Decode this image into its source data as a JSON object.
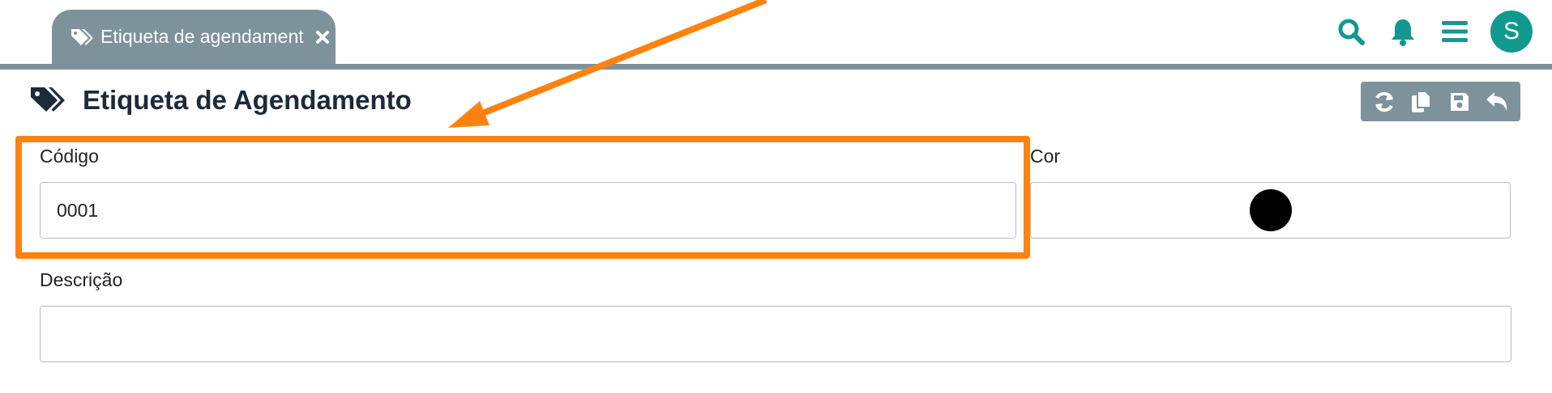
{
  "tab": {
    "label": "Etiqueta de agendament",
    "icon": "tags-icon",
    "close_icon": "close-icon"
  },
  "topbar": {
    "icons": [
      "search-icon",
      "bell-icon",
      "menu-icon"
    ],
    "avatar_initial": "S",
    "accent": "#12998e"
  },
  "header": {
    "title": "Etiqueta de Agendamento",
    "icon": "tags-icon"
  },
  "actions": {
    "icons": [
      "refresh-icon",
      "copy-icon",
      "save-icon",
      "undo-icon"
    ],
    "background": "#7e929c"
  },
  "form": {
    "codigo": {
      "label": "Código",
      "value": "0001"
    },
    "cor": {
      "label": "Cor",
      "value": "#000000"
    },
    "descricao": {
      "label": "Descrição",
      "value": ""
    }
  },
  "annotation": {
    "color": "#ff8210"
  }
}
